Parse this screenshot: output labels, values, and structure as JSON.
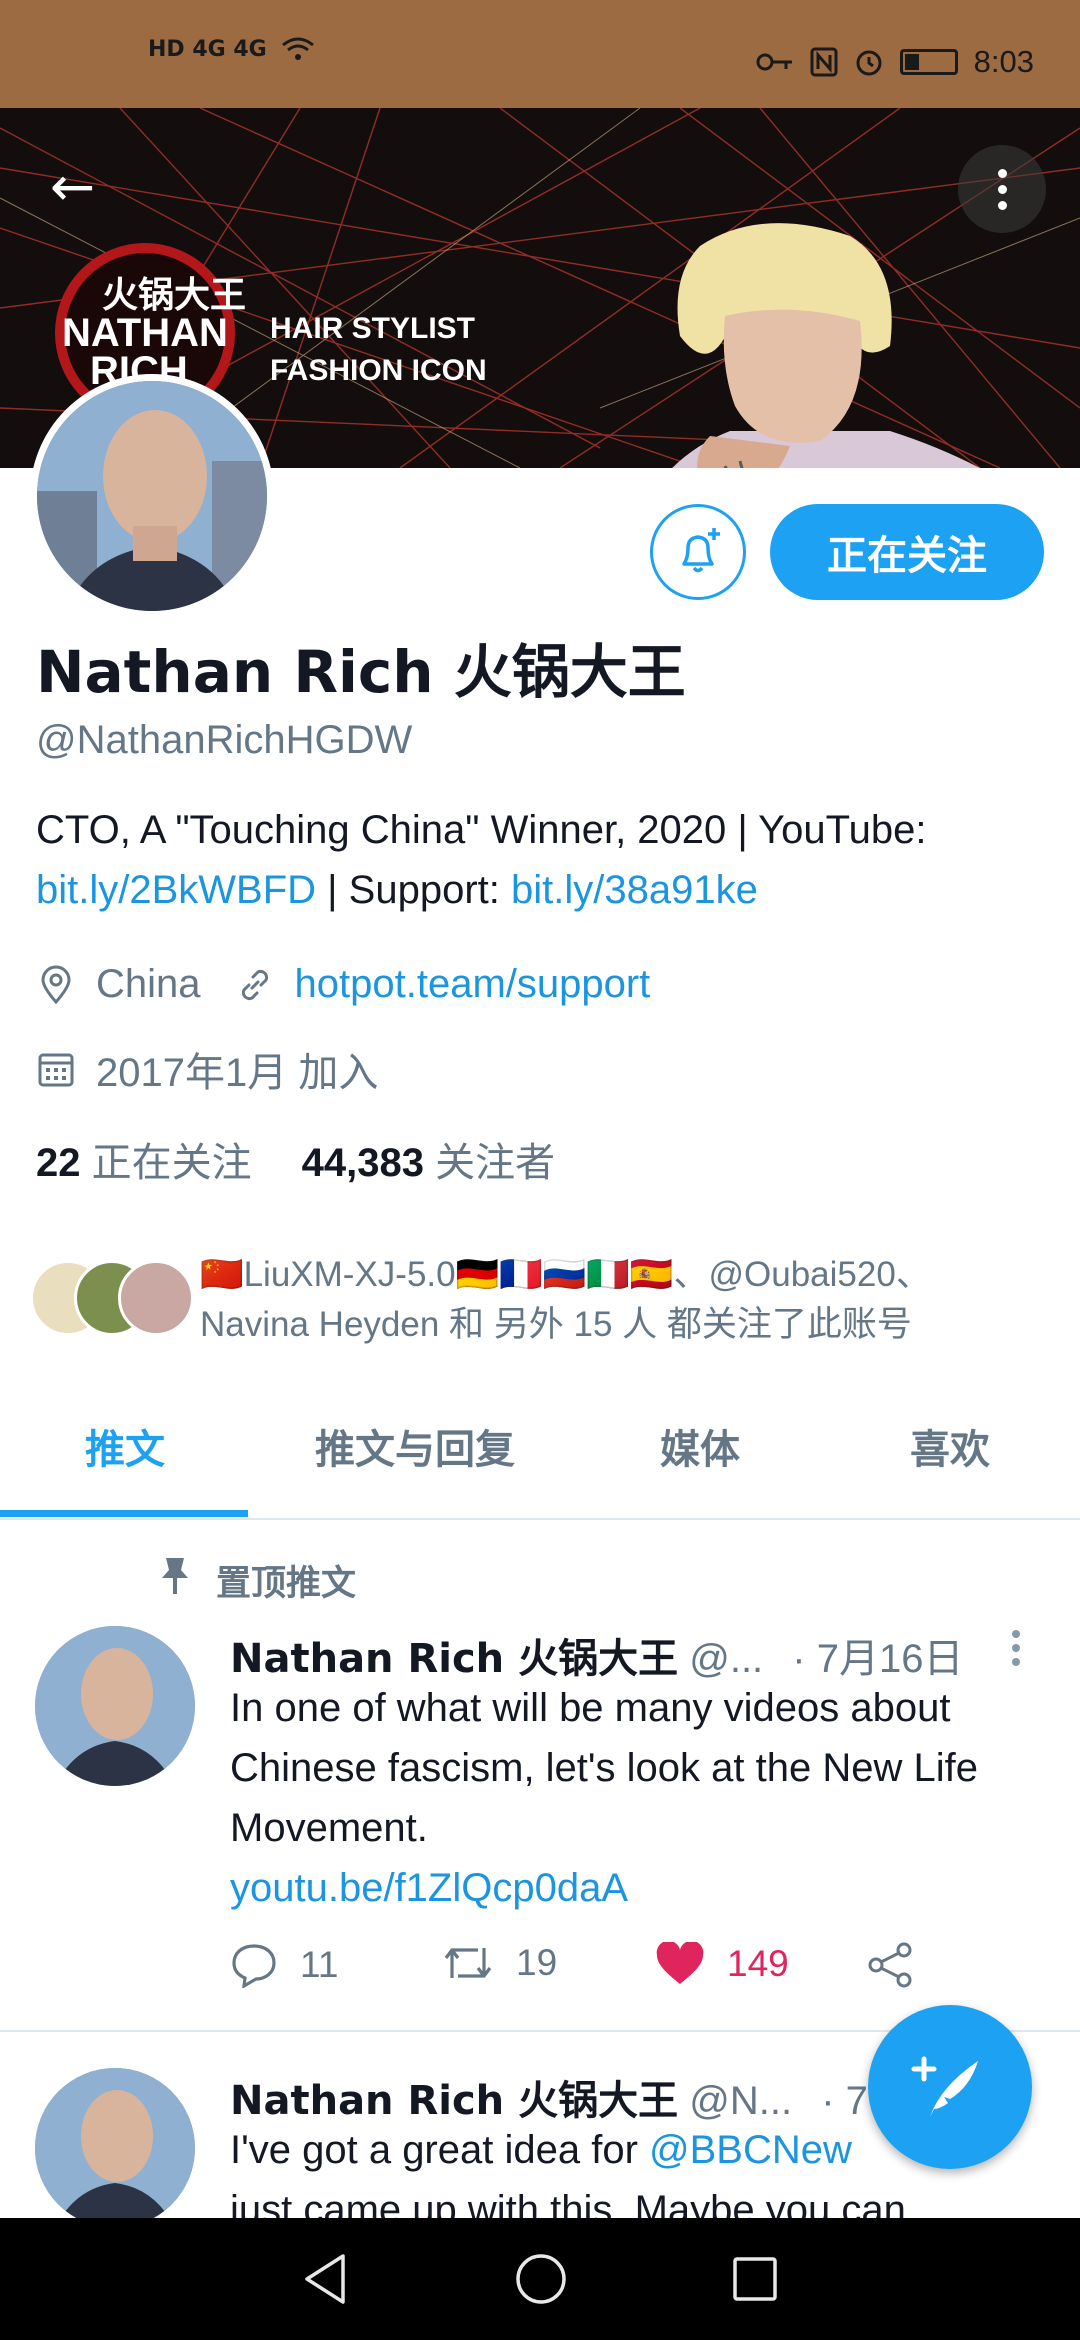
{
  "status_bar": {
    "left": "HD 4G 4G",
    "time": "8:03"
  },
  "header": {
    "banner_brand": "火锅大王",
    "banner_logo_line1": "NATHAN",
    "banner_logo_line2": "RICH",
    "banner_tag1": "HAIR STYLIST",
    "banner_tag2": "FASHION ICON"
  },
  "profile": {
    "follow_label": "正在关注",
    "name": "Nathan Rich 火锅大王",
    "handle": "@NathanRichHGDW",
    "bio_text1": "CTO, A \"Touching China\" Winner, 2020 | YouTube: ",
    "bio_link1": "bit.ly/2BkWBFD",
    "bio_text2": " | Support: ",
    "bio_link2": "bit.ly/38a91ke",
    "location": "China",
    "website": "hotpot.team/support",
    "joined": "2017年1月 加入",
    "following_count": "22",
    "following_label": "正在关注",
    "followers_count": "44,383",
    "followers_label": "关注者",
    "followed_by_line1": "🇨🇳LiuXM-XJ-5.0🇩🇪🇫🇷🇷🇺🇮🇹🇪🇸、@Oubai520、",
    "followed_by_line2": "Navina Heyden 和 另外 15 人 都关注了此账号"
  },
  "tabs": [
    {
      "label": "推文"
    },
    {
      "label": "推文与回复"
    },
    {
      "label": "媒体"
    },
    {
      "label": "喜欢"
    }
  ],
  "tweets": [
    {
      "pinned_label": "置顶推文",
      "author": "Nathan Rich 火锅大王",
      "handle": "@...",
      "date": "· 7月16日",
      "text": "In one of what will be many videos about Chinese fascism, let's look at the New Life Movement.",
      "link": "youtu.be/f1ZlQcp0daA",
      "replies": "11",
      "retweets": "19",
      "likes": "149"
    },
    {
      "author": "Nathan Rich 火锅大王",
      "handle": "@N...",
      "date": "· 7",
      "text1": "I've got a great idea for ",
      "mention": "@BBCNew",
      "text2": "just came up with this. Maybe you can"
    }
  ],
  "colors": {
    "accent": "#1da1f2",
    "like": "#e0245e",
    "status_bar": "#9c6b42"
  }
}
